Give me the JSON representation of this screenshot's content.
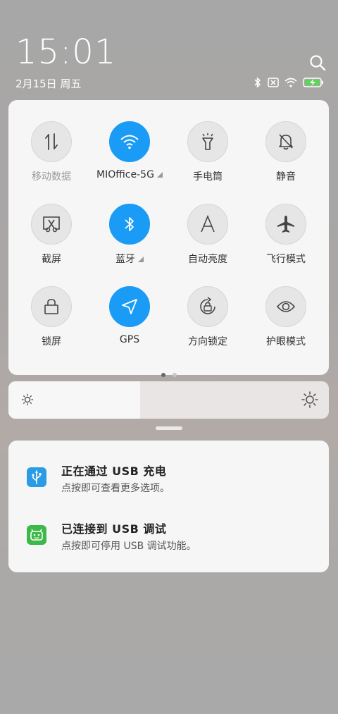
{
  "status": {
    "time": "15:01",
    "date": "2月15日 周五"
  },
  "quick_settings": {
    "tiles": [
      {
        "label": "移动数据",
        "active": false
      },
      {
        "label": "MIOffice-5G",
        "active": true
      },
      {
        "label": "手电筒",
        "active": false
      },
      {
        "label": "静音",
        "active": false
      },
      {
        "label": "截屏",
        "active": false
      },
      {
        "label": "蓝牙",
        "active": true
      },
      {
        "label": "自动亮度",
        "active": false
      },
      {
        "label": "飞行模式",
        "active": false
      },
      {
        "label": "锁屏",
        "active": false
      },
      {
        "label": "GPS",
        "active": true
      },
      {
        "label": "方向锁定",
        "active": false
      },
      {
        "label": "护眼模式",
        "active": false
      }
    ],
    "page_count": 2,
    "current_page": 1
  },
  "brightness": {
    "level": 0.41
  },
  "notifications": [
    {
      "title": "正在通过 USB 充电",
      "text": "点按即可查看更多选项。",
      "icon": "usb-icon",
      "icon_color": "#2a9be4"
    },
    {
      "title": "已连接到 USB 调试",
      "text": "点按即可停用 USB 调试功能。",
      "icon": "android-icon",
      "icon_color": "#3db94a"
    }
  ],
  "colors": {
    "accent": "#1a9bf5",
    "panel": "#f6f6f6"
  }
}
